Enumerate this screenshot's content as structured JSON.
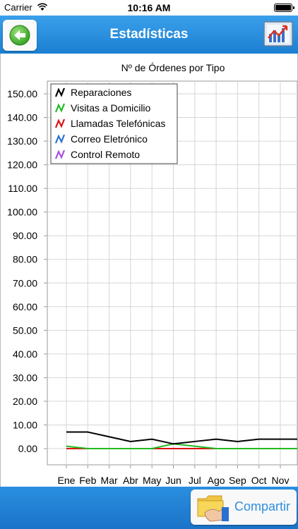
{
  "status_bar": {
    "carrier": "Carrier",
    "time": "10:16 AM"
  },
  "navbar": {
    "title": "Estadísticas"
  },
  "bottom": {
    "share_label": "Compartir"
  },
  "colors": {
    "nav_blue": "#1c7fd2",
    "accent": "#2f8fe0"
  },
  "icons": {
    "back": "green-left-arrow-icon",
    "chart": "stats-chart-icon",
    "share": "folder-share-icon"
  },
  "chart_data": {
    "type": "line",
    "title": "Nº de Órdenes por Tipo",
    "categories": [
      "Ene",
      "Feb",
      "Mar",
      "Abr",
      "May",
      "Jun",
      "Jul",
      "Ago",
      "Sep",
      "Oct",
      "Nov"
    ],
    "ylim": [
      0,
      150
    ],
    "yticks": [
      "0.00",
      "10.00",
      "20.00",
      "30.00",
      "40.00",
      "50.00",
      "60.00",
      "70.00",
      "80.00",
      "90.00",
      "100.00",
      "110.00",
      "120.00",
      "130.00",
      "140.00",
      "150.00"
    ],
    "grid": true,
    "legend_position": "top-left",
    "series": [
      {
        "name": "Reparaciones",
        "color": "#000000",
        "values": [
          7,
          7,
          5,
          3,
          4,
          2,
          3,
          4,
          3,
          4,
          4,
          4
        ]
      },
      {
        "name": "Visitas a Domicilio",
        "color": "#22bb22",
        "values": [
          1,
          0,
          0,
          0,
          0,
          2,
          1,
          0,
          0,
          0,
          0,
          0
        ]
      },
      {
        "name": "Llamadas Telefónicas",
        "color": "#dd1111",
        "values": [
          0,
          0,
          0,
          0,
          0,
          0,
          0,
          0,
          0,
          0,
          0,
          0
        ]
      },
      {
        "name": "Correo Eletrónico",
        "color": "#2a70d0",
        "values": [
          0,
          0,
          0,
          0,
          0,
          0,
          0,
          0,
          0,
          0,
          0,
          0
        ]
      },
      {
        "name": "Control Remoto",
        "color": "#a84ee0",
        "values": [
          0,
          0,
          0,
          0,
          0,
          0,
          0,
          0,
          0,
          0,
          0,
          0
        ]
      }
    ]
  }
}
